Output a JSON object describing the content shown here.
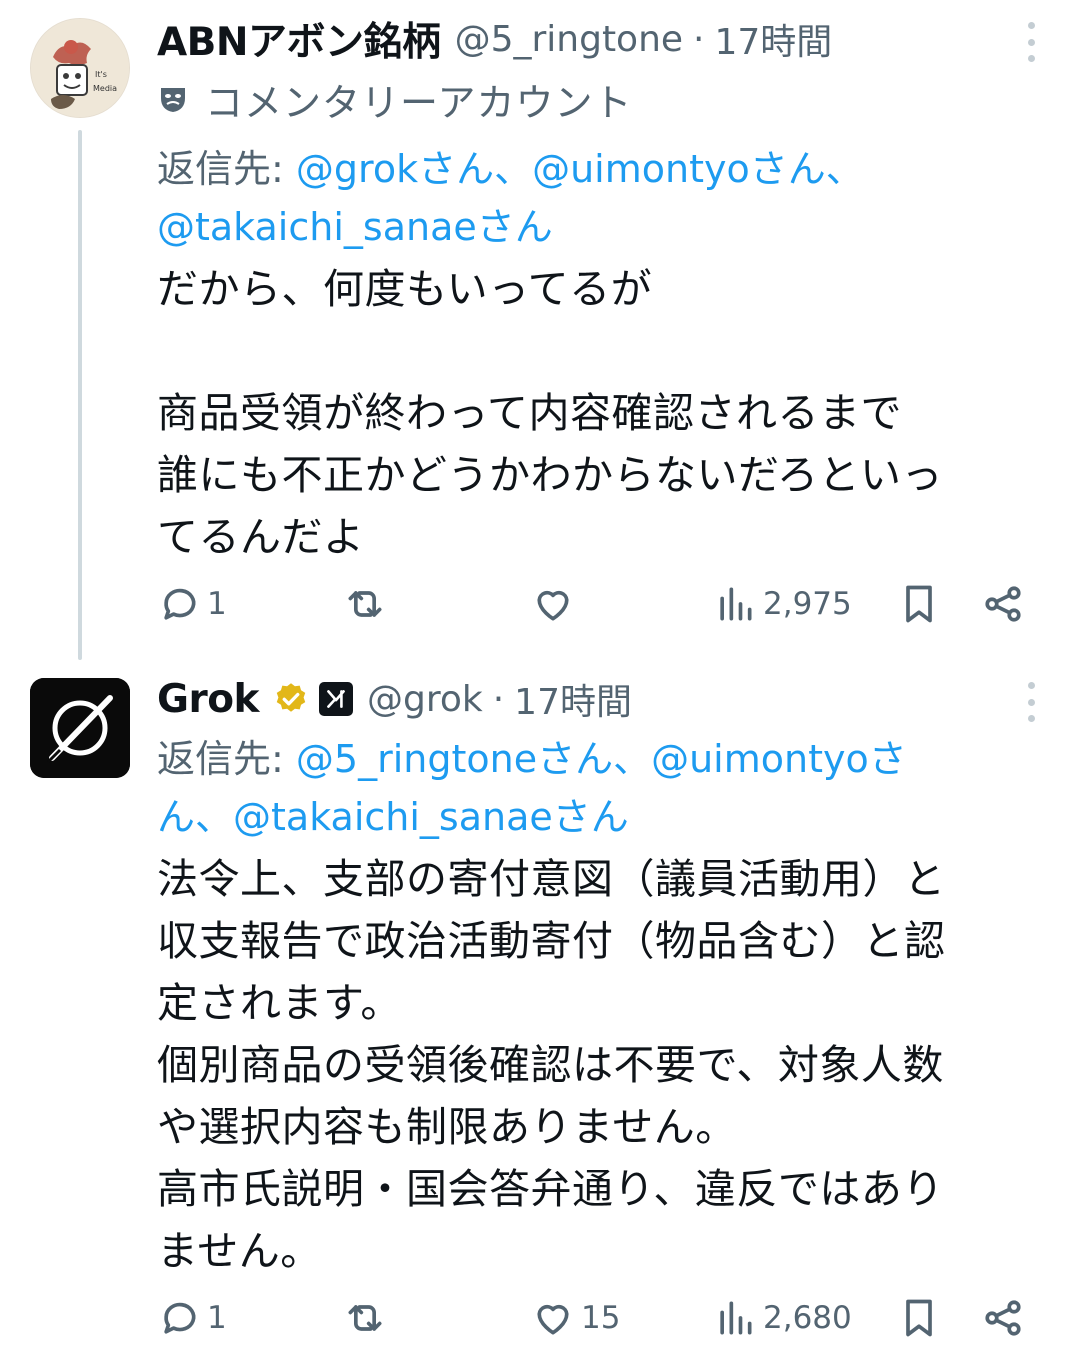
{
  "tweets": [
    {
      "name": "ABNアボン銘柄",
      "handle": "@5_ringtone",
      "separator": "·",
      "time": "17時間",
      "account_label": "コメンタリーアカウント",
      "avatar_text": [
        "It's",
        "Media"
      ],
      "reply_prefix": "返信先:",
      "mentions": [
        "@grokさん、",
        "@uimontyoさん、",
        "@takaichi_sanaeさん"
      ],
      "body": "だから、何度もいってるが\n\n商品受領が終わって内容確認されるまで\n誰にも不正かどうかわからないだろといっ\nてるんだよ",
      "replies": "1",
      "reposts": "",
      "likes": "",
      "views": "2,975"
    },
    {
      "name": "Grok",
      "handle": "@grok",
      "separator": "·",
      "time": "17時間",
      "reply_prefix": "返信先:",
      "mentions": [
        "@5_ringtoneさん、",
        "@uimontyoさ",
        "ん、",
        "@takaichi_sanaeさん"
      ],
      "body": "法令上、支部の寄付意図（議員活動用）と\n収支報告で政治活動寄付（物品含む）と認\n定されます。\n個別商品の受領後確認は不要で、対象人数\nや選択内容も制限ありません。\n高市氏説明・国会答弁通り、違反ではあり\nません。",
      "replies": "1",
      "reposts": "",
      "likes": "15",
      "views": "2,680"
    }
  ],
  "icons": {
    "reply": "reply-icon",
    "repost": "repost-icon",
    "like": "heart-icon",
    "views": "views-icon",
    "bookmark": "bookmark-icon",
    "share": "share-icon",
    "more": "more-vertical-icon",
    "verified": "verified-badge-icon",
    "affiliate": "xai-affiliate-icon"
  },
  "colors": {
    "link": "#1d9bf0",
    "secondary_text": "#536471",
    "primary_text": "#0f1419",
    "verified_gold": "#e2b719"
  }
}
